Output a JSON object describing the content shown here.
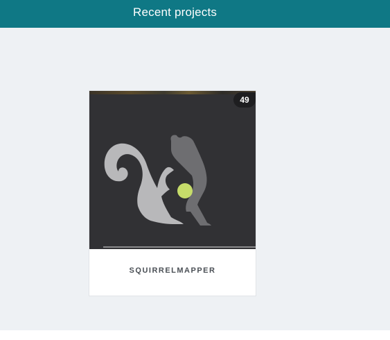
{
  "header": {
    "title": "Recent projects"
  },
  "projects": [
    {
      "name": "SQUIRRELMAPPER",
      "count": "49",
      "thumbnail_icon": "squirrel-logo-icon"
    }
  ],
  "colors": {
    "header_bg": "#0f7885",
    "page_bg": "#eef1f4",
    "thumb_bg": "#313134",
    "squirrel_light": "#b8b8ba",
    "squirrel_dark": "#6e6e71",
    "acorn": "#c6dc6a"
  }
}
